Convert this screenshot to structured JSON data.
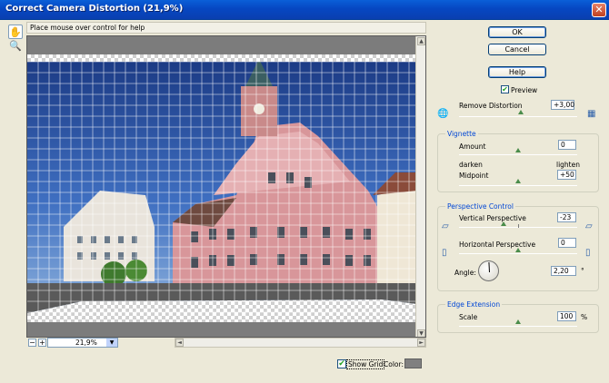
{
  "window": {
    "title": "Correct Camera Distortion (21,9%)",
    "close_glyph": "✕"
  },
  "tools": {
    "hand_glyph": "✋",
    "zoom_glyph": "🔍"
  },
  "helpbar": {
    "text": "Place mouse over control for help"
  },
  "zoom": {
    "minus": "−",
    "plus": "+",
    "value": "21,9%",
    "dropdown_glyph": "▼"
  },
  "scroll": {
    "up": "▲",
    "down": "▼",
    "left": "◄",
    "right": "►"
  },
  "buttons": {
    "ok": "OK",
    "cancel": "Cancel",
    "help": "Help"
  },
  "preview_toggle": {
    "label": "Preview",
    "checked": true,
    "check_glyph": "✔"
  },
  "remove_distortion": {
    "label": "Remove Distortion",
    "value": "+3,00",
    "slider_fraction": 0.52,
    "icons": [
      "globe-icon",
      "grid-distortion-icon"
    ],
    "glyphs": [
      "🌐",
      "▦"
    ]
  },
  "vignette": {
    "title": "Vignette",
    "amount": {
      "label": "Amount",
      "value": "0",
      "slider_fraction": 0.5
    },
    "darken": "darken",
    "lighten": "lighten",
    "midpoint": {
      "label": "Midpoint",
      "value": "+50",
      "slider_fraction": 0.5
    }
  },
  "perspective": {
    "title": "Perspective Control",
    "vertical": {
      "label": "Vertical Perspective",
      "value": "-23",
      "slider_fraction": 0.38,
      "glyph_left": "▱",
      "glyph_right": "▱"
    },
    "horizontal": {
      "label": "Horizontal Perspective",
      "value": "0",
      "slider_fraction": 0.5,
      "glyph_left": "▯",
      "glyph_right": "▯"
    },
    "angle": {
      "label": "Angle:",
      "value": "2,20",
      "unit": "°"
    }
  },
  "edge": {
    "title": "Edge Extension",
    "scale": {
      "label": "Scale",
      "value": "100",
      "unit": "%",
      "slider_fraction": 0.5
    }
  },
  "grid": {
    "show_label": "Show Grid",
    "checked": true,
    "check_glyph": "✔",
    "color_label": "Color:",
    "color": "#808080"
  }
}
